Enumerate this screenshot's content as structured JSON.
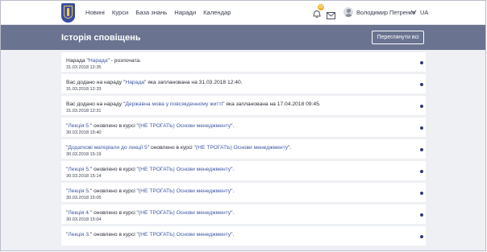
{
  "nav": {
    "items": [
      "Новині",
      "Курси",
      "База знань",
      "Наради",
      "Календар"
    ]
  },
  "header": {
    "notifications_count": "23",
    "user_name": "Володимир Петренко",
    "language": "UA"
  },
  "page": {
    "title": "Історія сповіщень",
    "mark_all_button": "Переглянути всі"
  },
  "notifications": [
    {
      "parts": [
        "Нарада \"",
        "Нарада",
        "\" - розпочата."
      ],
      "date": "31.03.2018 12:35"
    },
    {
      "parts": [
        "Вас додано на нараду \"",
        "Нарада",
        "\" яка запланована на 31.03.2018 12:40."
      ],
      "date": "31.03.2018 12:33"
    },
    {
      "parts": [
        "Вас додано на нараду \"",
        "Державна мова у повсякденному житті",
        "\" яка запланована на 17.04.2018 09:45."
      ],
      "date": "31.03.2018 12:31"
    },
    {
      "parts": [
        "\"",
        "Лекція 5.",
        "\" оновлено в курсі \"",
        "(НЕ ТРОГАТЬ) Основи менеджменту",
        "\"."
      ],
      "date": "30.03.2018 15:40"
    },
    {
      "parts": [
        "\"",
        "Додаткові матеріали до лекції 5",
        "\" оновлено в курсі \"",
        "(НЕ ТРОГАТЬ) Основи менеджменту",
        "\"."
      ],
      "date": "30.03.2018 15:19"
    },
    {
      "parts": [
        "\"",
        "Лекція 5.",
        "\" оновлено в курсі \"",
        "(НЕ ТРОГАТЬ) Основи менеджменту",
        "\"."
      ],
      "date": "30.03.2018 15:14"
    },
    {
      "parts": [
        "\"",
        "Лекція 5.",
        "\" оновлено в курсі \"",
        "(НЕ ТРОГАТЬ) Основи менеджменту",
        "\"."
      ],
      "date": "30.03.2018 15:05"
    },
    {
      "parts": [
        "\"",
        "Лекція 4.",
        "\" оновлено в курсі \"",
        "(НЕ ТРОГАТЬ) Основи менеджменту",
        "\"."
      ],
      "date": "30.03.2018 15:04"
    },
    {
      "parts": [
        "\"",
        "Лекція 3.",
        "\" оновлено в курсі \"",
        "(НЕ ТРОГАТЬ) Основи менеджменту",
        "\"."
      ],
      "date": ""
    }
  ],
  "colors": {
    "header_band": "#6a7390",
    "link": "#3d57a6",
    "unread_dot": "#2f3b78",
    "badge": "#f0b429"
  },
  "icons": {
    "logo": "kyiv-coat-of-arms-icon",
    "notifications": "bell-icon",
    "messages": "envelope-icon",
    "user": "avatar-icon",
    "dropdown": "chevron-down-icon",
    "unread": "unread-dot-icon"
  }
}
